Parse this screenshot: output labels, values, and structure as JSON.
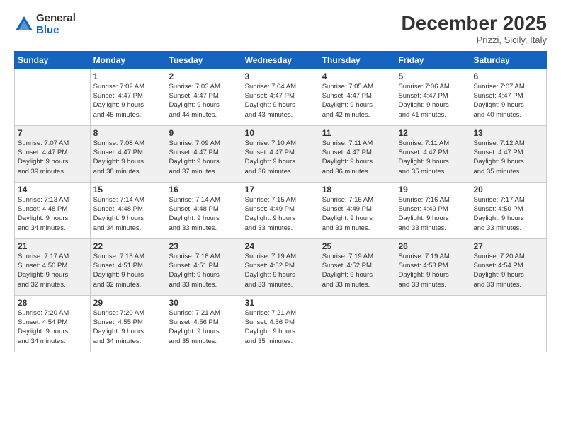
{
  "logo": {
    "general": "General",
    "blue": "Blue"
  },
  "title": "December 2025",
  "subtitle": "Prizzi, Sicily, Italy",
  "days_header": [
    "Sunday",
    "Monday",
    "Tuesday",
    "Wednesday",
    "Thursday",
    "Friday",
    "Saturday"
  ],
  "weeks": [
    [
      {
        "day": "",
        "info": ""
      },
      {
        "day": "1",
        "info": "Sunrise: 7:02 AM\nSunset: 4:47 PM\nDaylight: 9 hours\nand 45 minutes."
      },
      {
        "day": "2",
        "info": "Sunrise: 7:03 AM\nSunset: 4:47 PM\nDaylight: 9 hours\nand 44 minutes."
      },
      {
        "day": "3",
        "info": "Sunrise: 7:04 AM\nSunset: 4:47 PM\nDaylight: 9 hours\nand 43 minutes."
      },
      {
        "day": "4",
        "info": "Sunrise: 7:05 AM\nSunset: 4:47 PM\nDaylight: 9 hours\nand 42 minutes."
      },
      {
        "day": "5",
        "info": "Sunrise: 7:06 AM\nSunset: 4:47 PM\nDaylight: 9 hours\nand 41 minutes."
      },
      {
        "day": "6",
        "info": "Sunrise: 7:07 AM\nSunset: 4:47 PM\nDaylight: 9 hours\nand 40 minutes."
      }
    ],
    [
      {
        "day": "7",
        "info": "Sunrise: 7:07 AM\nSunset: 4:47 PM\nDaylight: 9 hours\nand 39 minutes."
      },
      {
        "day": "8",
        "info": "Sunrise: 7:08 AM\nSunset: 4:47 PM\nDaylight: 9 hours\nand 38 minutes."
      },
      {
        "day": "9",
        "info": "Sunrise: 7:09 AM\nSunset: 4:47 PM\nDaylight: 9 hours\nand 37 minutes."
      },
      {
        "day": "10",
        "info": "Sunrise: 7:10 AM\nSunset: 4:47 PM\nDaylight: 9 hours\nand 36 minutes."
      },
      {
        "day": "11",
        "info": "Sunrise: 7:11 AM\nSunset: 4:47 PM\nDaylight: 9 hours\nand 36 minutes."
      },
      {
        "day": "12",
        "info": "Sunrise: 7:11 AM\nSunset: 4:47 PM\nDaylight: 9 hours\nand 35 minutes."
      },
      {
        "day": "13",
        "info": "Sunrise: 7:12 AM\nSunset: 4:47 PM\nDaylight: 9 hours\nand 35 minutes."
      }
    ],
    [
      {
        "day": "14",
        "info": "Sunrise: 7:13 AM\nSunset: 4:48 PM\nDaylight: 9 hours\nand 34 minutes."
      },
      {
        "day": "15",
        "info": "Sunrise: 7:14 AM\nSunset: 4:48 PM\nDaylight: 9 hours\nand 34 minutes."
      },
      {
        "day": "16",
        "info": "Sunrise: 7:14 AM\nSunset: 4:48 PM\nDaylight: 9 hours\nand 33 minutes."
      },
      {
        "day": "17",
        "info": "Sunrise: 7:15 AM\nSunset: 4:49 PM\nDaylight: 9 hours\nand 33 minutes."
      },
      {
        "day": "18",
        "info": "Sunrise: 7:16 AM\nSunset: 4:49 PM\nDaylight: 9 hours\nand 33 minutes."
      },
      {
        "day": "19",
        "info": "Sunrise: 7:16 AM\nSunset: 4:49 PM\nDaylight: 9 hours\nand 33 minutes."
      },
      {
        "day": "20",
        "info": "Sunrise: 7:17 AM\nSunset: 4:50 PM\nDaylight: 9 hours\nand 33 minutes."
      }
    ],
    [
      {
        "day": "21",
        "info": "Sunrise: 7:17 AM\nSunset: 4:50 PM\nDaylight: 9 hours\nand 32 minutes."
      },
      {
        "day": "22",
        "info": "Sunrise: 7:18 AM\nSunset: 4:51 PM\nDaylight: 9 hours\nand 32 minutes."
      },
      {
        "day": "23",
        "info": "Sunrise: 7:18 AM\nSunset: 4:51 PM\nDaylight: 9 hours\nand 33 minutes."
      },
      {
        "day": "24",
        "info": "Sunrise: 7:19 AM\nSunset: 4:52 PM\nDaylight: 9 hours\nand 33 minutes."
      },
      {
        "day": "25",
        "info": "Sunrise: 7:19 AM\nSunset: 4:52 PM\nDaylight: 9 hours\nand 33 minutes."
      },
      {
        "day": "26",
        "info": "Sunrise: 7:19 AM\nSunset: 4:53 PM\nDaylight: 9 hours\nand 33 minutes."
      },
      {
        "day": "27",
        "info": "Sunrise: 7:20 AM\nSunset: 4:54 PM\nDaylight: 9 hours\nand 33 minutes."
      }
    ],
    [
      {
        "day": "28",
        "info": "Sunrise: 7:20 AM\nSunset: 4:54 PM\nDaylight: 9 hours\nand 34 minutes."
      },
      {
        "day": "29",
        "info": "Sunrise: 7:20 AM\nSunset: 4:55 PM\nDaylight: 9 hours\nand 34 minutes."
      },
      {
        "day": "30",
        "info": "Sunrise: 7:21 AM\nSunset: 4:56 PM\nDaylight: 9 hours\nand 35 minutes."
      },
      {
        "day": "31",
        "info": "Sunrise: 7:21 AM\nSunset: 4:56 PM\nDaylight: 9 hours\nand 35 minutes."
      },
      {
        "day": "",
        "info": ""
      },
      {
        "day": "",
        "info": ""
      },
      {
        "day": "",
        "info": ""
      }
    ]
  ]
}
